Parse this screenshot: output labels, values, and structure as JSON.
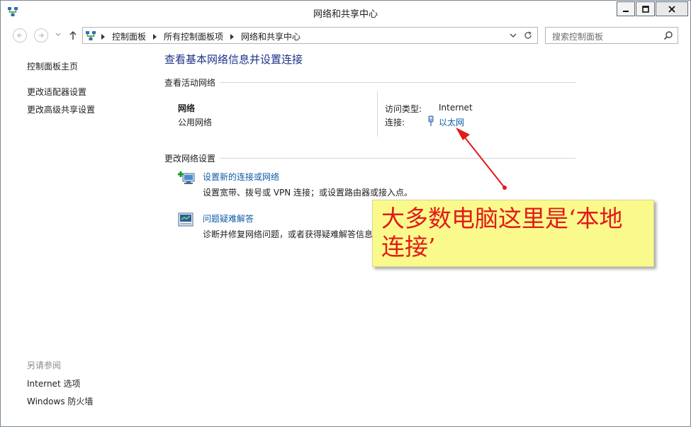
{
  "window": {
    "title": "网络和共享中心"
  },
  "address": {
    "breadcrumbs": [
      "控制面板",
      "所有控制面板项",
      "网络和共享中心"
    ]
  },
  "search": {
    "placeholder": "搜索控制面板"
  },
  "left_nav": {
    "items": [
      "控制面板主页",
      "更改适配器设置",
      "更改高级共享设置"
    ],
    "see_also_label": "另请参阅",
    "see_also_items": [
      "Internet 选项",
      "Windows 防火墙"
    ]
  },
  "main": {
    "title": "查看基本网络信息并设置连接",
    "active_header": "查看活动网络",
    "network": {
      "name": "网络",
      "type": "公用网络",
      "access_label": "访问类型:",
      "access_value": "Internet",
      "connection_label": "连接:",
      "connection_value": "以太网"
    },
    "change_header": "更改网络设置",
    "tasks": [
      {
        "title": "设置新的连接或网络",
        "desc": "设置宽带、拨号或 VPN 连接；或设置路由器或接入点。",
        "icon": "network-setup-icon"
      },
      {
        "title": "问题疑难解答",
        "desc": "诊断并修复网络问题，或者获得疑难解答信息",
        "icon": "troubleshoot-icon"
      }
    ]
  },
  "annotation": {
    "text": "大多数电脑这里是‘本地连接’",
    "color": "#e21a1a",
    "background": "#fafa8c"
  }
}
